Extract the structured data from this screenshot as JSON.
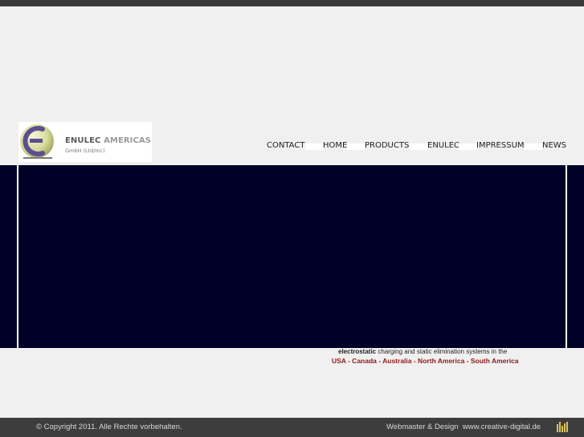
{
  "logo": {
    "name": "ENULEC",
    "name_suffix": "AMERICAS",
    "subtitle": "GmbH (Ltd/Inc)",
    "colors": {
      "ring": "#5b4f8f",
      "sphere": "#d7dc9a",
      "text": "#5a5a5a"
    }
  },
  "nav": {
    "items": [
      {
        "label": "CONTACT"
      },
      {
        "label": "HOME"
      },
      {
        "label": "PRODUCTS"
      },
      {
        "label": "ENULEC"
      },
      {
        "label": "IMPRESSUM"
      },
      {
        "label": "NEWS"
      }
    ]
  },
  "hero": {
    "background": "#000028"
  },
  "tagline": {
    "bold": "electrostatic",
    "rest": " charging and static elimination systems in the",
    "regions": "USA - Canada - Australia - North America - South America",
    "region_color": "#8b1a1a"
  },
  "footer": {
    "copyright": "© Copyright 2011. Alle Rechte vorbehalten.",
    "credit_label": "Webmaster & Design",
    "credit_link": "www.creative-digital.de",
    "icon": "bars-icon"
  }
}
